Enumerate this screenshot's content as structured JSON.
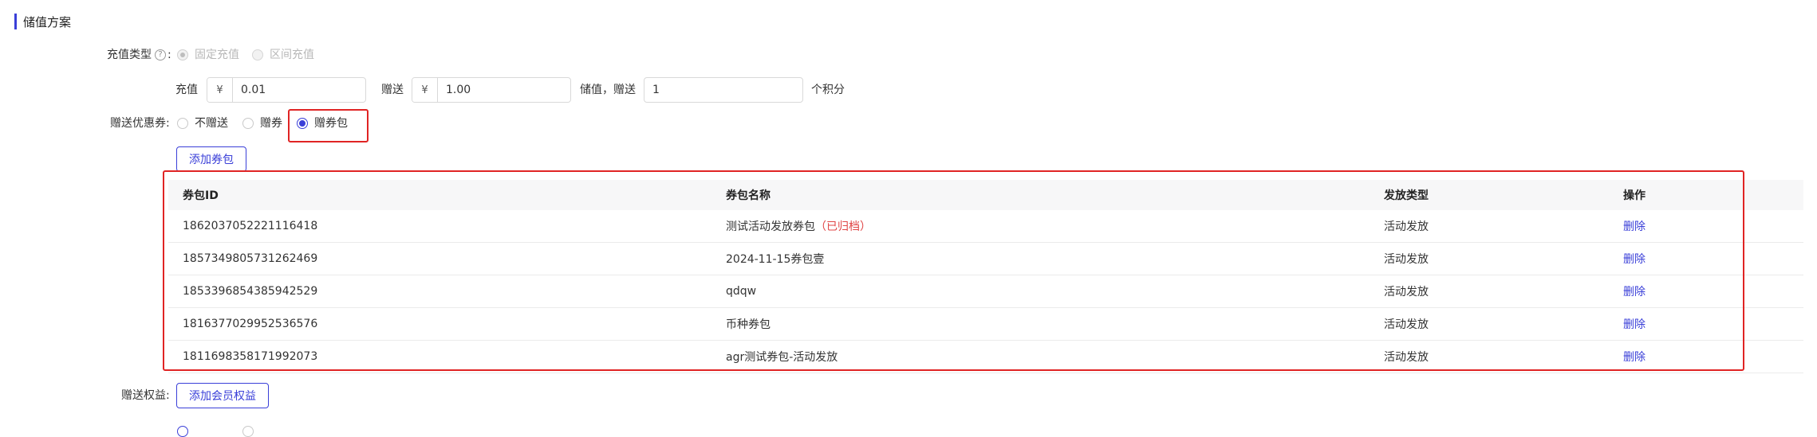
{
  "section": {
    "title": "储值方案"
  },
  "recharge_type": {
    "label": "充值类型",
    "suffix": ":",
    "options": [
      {
        "label": "固定充值",
        "state": "disabled-checked"
      },
      {
        "label": "区间充值",
        "state": "disabled"
      }
    ]
  },
  "amounts": {
    "recharge_label": "充值",
    "recharge_prefix": "¥",
    "recharge_value": "0.01",
    "gift_label": "赠送",
    "gift_prefix": "¥",
    "gift_value": "1.00",
    "store_label": "储值，赠送",
    "points_value": "1",
    "points_unit": "个积分"
  },
  "coupon_gift": {
    "label": "赠送优惠券:",
    "options": [
      {
        "label": "不赠送",
        "checked": false
      },
      {
        "label": "赠券",
        "checked": false
      },
      {
        "label": "赠券包",
        "checked": true
      }
    ],
    "add_button": "添加券包"
  },
  "table": {
    "columns": [
      "券包ID",
      "券包名称",
      "发放类型",
      "操作"
    ],
    "rows": [
      {
        "id": "1862037052221116418",
        "name": "测试活动发放券包",
        "tag": "（已归档）",
        "type": "活动发放",
        "action": "删除"
      },
      {
        "id": "1857349805731262469",
        "name": "2024-11-15券包壹",
        "tag": "",
        "type": "活动发放",
        "action": "删除"
      },
      {
        "id": "1853396854385942529",
        "name": "qdqw",
        "tag": "",
        "type": "活动发放",
        "action": "删除"
      },
      {
        "id": "1816377029952536576",
        "name": "币种券包",
        "tag": "",
        "type": "活动发放",
        "action": "删除"
      },
      {
        "id": "1811698358171992073",
        "name": "agr测试券包-活动发放",
        "tag": "",
        "type": "活动发放",
        "action": "删除"
      }
    ]
  },
  "benefits": {
    "label": "赠送权益:",
    "add_button": "添加会员权益"
  },
  "colors": {
    "accent": "#3a3fd8",
    "highlight": "#e02424",
    "archived": "#e04545"
  }
}
